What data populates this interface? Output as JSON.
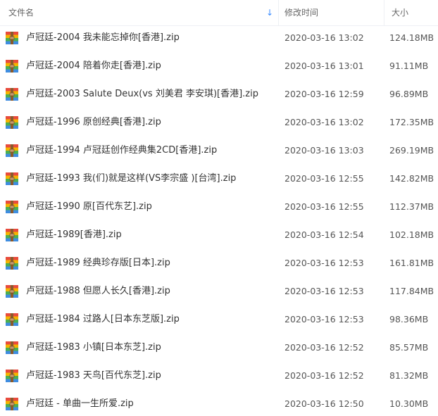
{
  "header": {
    "name_label": "文件名",
    "modified_label": "修改时间",
    "size_label": "大小",
    "sort_indicator": "↓"
  },
  "colors": {
    "sort_arrow": "#3b8cff",
    "divider": "#eef0f4"
  },
  "icon_semantic": "zip-archive-icon",
  "files": [
    {
      "name": "卢冠廷-2004 我未能忘掉你[香港].zip",
      "modified": "2020-03-16 13:02",
      "size": "124.18MB"
    },
    {
      "name": "卢冠廷-2004 陪着你走[香港].zip",
      "modified": "2020-03-16 13:01",
      "size": "91.11MB"
    },
    {
      "name": "卢冠廷-2003 Salute Deux(vs 刘美君 李安琪)[香港].zip",
      "modified": "2020-03-16 12:59",
      "size": "96.89MB"
    },
    {
      "name": "卢冠廷-1996 原创经典[香港].zip",
      "modified": "2020-03-16 13:02",
      "size": "172.35MB"
    },
    {
      "name": "卢冠廷-1994 卢冠廷创作经典集2CD[香港].zip",
      "modified": "2020-03-16 13:03",
      "size": "269.19MB"
    },
    {
      "name": "卢冠廷-1993 我(们)就是这样(VS李宗盛 )[台湾].zip",
      "modified": "2020-03-16 12:55",
      "size": "142.82MB"
    },
    {
      "name": "卢冠廷-1990 原[百代东艺].zip",
      "modified": "2020-03-16 12:55",
      "size": "112.37MB"
    },
    {
      "name": "卢冠廷-1989[香港].zip",
      "modified": "2020-03-16 12:54",
      "size": "102.18MB"
    },
    {
      "name": "卢冠廷-1989 经典珍存版[日本].zip",
      "modified": "2020-03-16 12:53",
      "size": "161.81MB"
    },
    {
      "name": "卢冠廷-1988 但愿人长久[香港].zip",
      "modified": "2020-03-16 12:53",
      "size": "117.84MB"
    },
    {
      "name": "卢冠廷-1984 过路人[日本东芝版].zip",
      "modified": "2020-03-16 12:53",
      "size": "98.36MB"
    },
    {
      "name": "卢冠廷-1983 小镇[日本东芝].zip",
      "modified": "2020-03-16 12:52",
      "size": "85.57MB"
    },
    {
      "name": "卢冠廷-1983 天鸟[百代东芝].zip",
      "modified": "2020-03-16 12:52",
      "size": "81.32MB"
    },
    {
      "name": "卢冠廷 - 单曲一生所爱.zip",
      "modified": "2020-03-16 12:50",
      "size": "10.30MB"
    }
  ]
}
